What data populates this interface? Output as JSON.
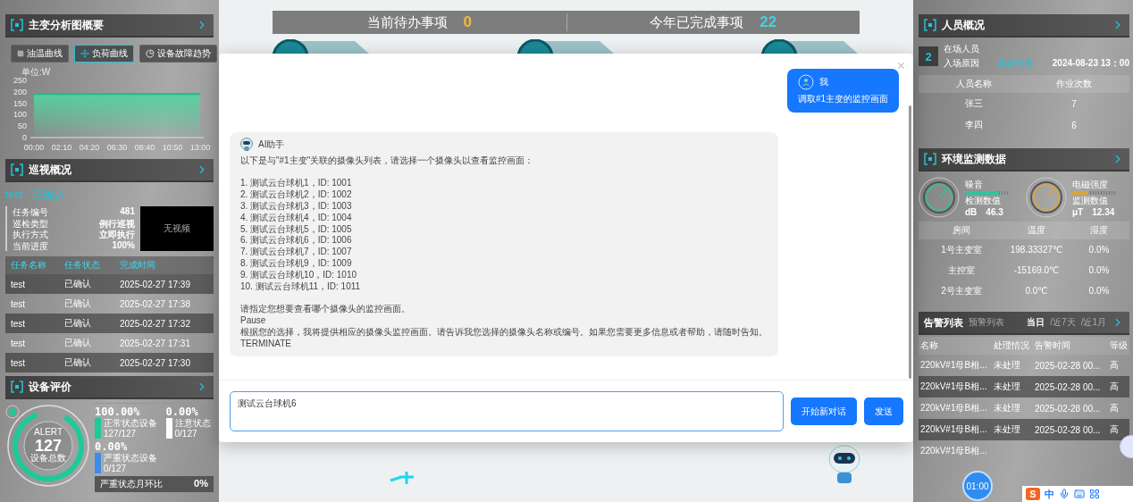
{
  "left": {
    "analysis": {
      "title": "主变分析图概要",
      "tabs": [
        {
          "label": "油温曲线",
          "selected": false
        },
        {
          "label": "负荷曲线",
          "selected": true
        },
        {
          "label": "设备故障趋势",
          "selected": false
        }
      ],
      "chart_data": {
        "type": "area",
        "ylabel": "单位:W",
        "x": [
          "00:00",
          "02:10",
          "04:20",
          "06:30",
          "08:40",
          "10:50",
          "13:00"
        ],
        "series": [
          {
            "color": "#4fd6a0",
            "values": [
              190,
              190,
              190,
              190,
              190,
              190,
              190
            ]
          }
        ],
        "ylim": [
          0,
          250
        ],
        "yticks": [
          0,
          50,
          100,
          150,
          200,
          250
        ]
      }
    },
    "patrol": {
      "title": "巡视概况",
      "status": "test - 已确认",
      "fields": [
        {
          "label": "任务编号",
          "value": "481"
        },
        {
          "label": "巡检类型",
          "value": "例行巡视"
        },
        {
          "label": "执行方式",
          "value": "立即执行"
        },
        {
          "label": "当前进度",
          "value": "100%"
        }
      ],
      "video": "无视频",
      "columns": [
        "任务名称",
        "任务状态",
        "完成时间"
      ],
      "rows": [
        [
          "test",
          "已确认",
          "2025-02-27 17:39"
        ],
        [
          "test",
          "已确认",
          "2025-02-27 17:38"
        ],
        [
          "test",
          "已确认",
          "2025-02-27 17:32"
        ],
        [
          "test",
          "已确认",
          "2025-02-27 17:31"
        ],
        [
          "test",
          "已确认",
          "2025-02-27 17:30"
        ]
      ]
    },
    "evaluation": {
      "title": "设备评价",
      "caption": "ALERT",
      "total": "127",
      "total_label": "设备总数",
      "stats": [
        {
          "percent": "100.00%",
          "label": "正常状态设备",
          "count": "127/127",
          "color": "#1ec99a"
        },
        {
          "percent": "0.00%",
          "label": "注意状态",
          "count": "0/127",
          "color": "#ffffff"
        },
        {
          "percent": "0.00%",
          "label": "严重状态设备",
          "count": "0/127",
          "color": "#3a8ee6"
        }
      ],
      "ratio": {
        "label": "严重状态月环比",
        "value": "0%"
      }
    }
  },
  "center": {
    "todo": {
      "label": "当前待办事项",
      "value": "0"
    },
    "done": {
      "label": "今年已完成事项",
      "value": "22"
    }
  },
  "right": {
    "personnel": {
      "title": "人员概况",
      "badge": "2",
      "present_label": "在场人员",
      "reason_label": "入场原因",
      "reason": "检修任务",
      "time": "2024-08-23 13：00",
      "columns": [
        "人员名称",
        "作业次数"
      ],
      "rows": [
        [
          "张三",
          "7"
        ],
        [
          "李四",
          "6"
        ]
      ]
    },
    "environment": {
      "title": "环境监测数据",
      "meters": [
        {
          "name": "噪音",
          "level": 0.75,
          "reading_label": "检测数值",
          "unit": "dB",
          "value": "46.3",
          "color": "#2ec4a0"
        },
        {
          "name": "电磁强度",
          "level": 0.35,
          "reading_label": "监测数值",
          "unit": "μT",
          "value": "12.34",
          "color": "#d9a53a"
        }
      ],
      "columns": [
        "房间",
        "温度",
        "湿度"
      ],
      "rows": [
        [
          "1号主变室",
          "198.33327℃",
          "0.0%"
        ],
        [
          "主控室",
          "-15169.0℃",
          "0.0%"
        ],
        [
          "2号主变室",
          "0.0℃",
          "0.0%"
        ]
      ]
    },
    "alerts": {
      "tabs": [
        {
          "label": "告警列表",
          "selected": true
        },
        {
          "label": "预警列表",
          "selected": false
        }
      ],
      "ranges": [
        {
          "label": "当日",
          "selected": true
        },
        {
          "label": "/近7天",
          "selected": false
        },
        {
          "label": "/近1月",
          "selected": false
        }
      ],
      "columns": [
        "名称",
        "处理情况",
        "告警时间",
        "等级"
      ],
      "rows": [
        [
          "220kV#1母B相...",
          "未处理",
          "2025-02-28 00...",
          "高"
        ],
        [
          "220kV#1母B相...",
          "未处理",
          "2025-02-28 00...",
          "高"
        ],
        [
          "220kV#1母B相...",
          "未处理",
          "2025-02-28 00...",
          "高"
        ],
        [
          "220kV#1母B相...",
          "未处理",
          "2025-02-28 00...",
          "高"
        ],
        [
          "220kV#1母B相..."
        ]
      ]
    }
  },
  "timer": "01:00",
  "ime": {
    "logo": "S",
    "mode": "中"
  },
  "dialog": {
    "messages": [
      {
        "kind": "user",
        "sender": "我",
        "paragraphs": [
          [
            "调取#1主变的监控画面"
          ]
        ]
      },
      {
        "kind": "assistant",
        "sender": "AI助手",
        "paragraphs": [
          [
            "以下是与\"#1主变\"关联的摄像头列表，请选择一个摄像头以查看监控画面："
          ],
          [
            "1. 测试云台球机1，ID: 1001",
            "2. 测试云台球机2，ID: 1002",
            "3. 测试云台球机3，ID: 1003",
            "4. 测试云台球机4，ID: 1004",
            "5. 测试云台球机5，ID: 1005",
            "6. 测试云台球机6，ID: 1006",
            "7. 测试云台球机7，ID: 1007",
            "8. 测试云台球机9，ID: 1009",
            "9. 测试云台球机10，ID: 1010",
            "10. 测试云台球机11，ID: 1011"
          ],
          [
            "请指定您想要查看哪个摄像头的监控画面。",
            "Pause",
            "根据您的选择，我将提供相应的摄像头监控画面。请告诉我您选择的摄像头名称或编号。如果您需要更多信息或者帮助，请随时告知。",
            "TERMINATE"
          ]
        ]
      }
    ],
    "input": {
      "value": "测试云台球机6"
    },
    "buttons": [
      "开始新对话",
      "发送"
    ]
  }
}
